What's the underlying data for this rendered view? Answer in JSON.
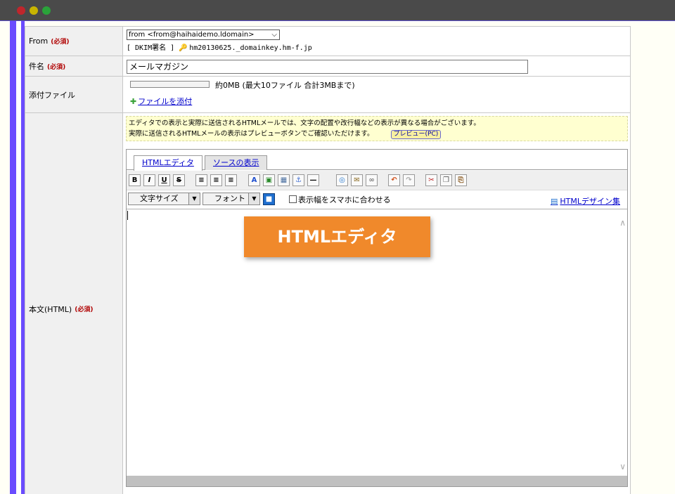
{
  "window": {
    "controls": [
      "close",
      "minimize",
      "maximize"
    ]
  },
  "rows": {
    "from": {
      "label": "From",
      "required": "(必須)",
      "select_value": "from <from@haihaidemo.ldomain>",
      "dkim_label": "[ DKIM署名 ]",
      "dkim_value": "hm20130625._domainkey.hm-f.jp"
    },
    "subject": {
      "label": "件名",
      "required": "(必須)",
      "value": "メールマガジン"
    },
    "attachment": {
      "label": "添付ファイル",
      "usage_text": "約0MB (最大10ファイル 合計3MBまで)",
      "add_link": "ファイルを添付"
    },
    "body": {
      "label": "本文(HTML)",
      "required": "(必須)",
      "notice_line1": "エディタでの表示と実際に送信されるHTMLメールでは、文字の配置や改行幅などの表示が異なる場合がございます。",
      "notice_line2": "実際に送信されるHTMLメールの表示はプレビューボタンでご確認いただけます。",
      "preview_button": "プレビュー(PC)"
    }
  },
  "editor": {
    "tabs": {
      "html_editor": "HTMLエディタ",
      "source": "ソースの表示"
    },
    "toolbar": {
      "bold": "B",
      "italic": "I",
      "underline": "U",
      "strike": "S"
    },
    "font_size_label": "文字サイズ",
    "font_label": "フォント",
    "smartphone_fit_label": "表示幅をスマホに合わせる",
    "design_link": "HTMLデザイン集"
  },
  "overlay_label": "HTMLエディタ",
  "colors": {
    "accent": "#6a4cff",
    "overlay": "#f0892b",
    "required": "#b00000",
    "link": "#0000cc"
  }
}
